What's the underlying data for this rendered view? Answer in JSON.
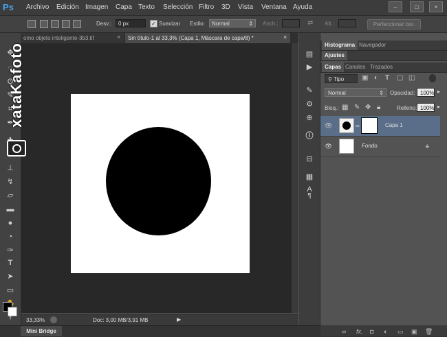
{
  "app": {
    "logo": "Ps"
  },
  "menu": [
    "Archivo",
    "Edición",
    "Imagen",
    "Capa",
    "Texto",
    "Selección",
    "Filtro",
    "3D",
    "Vista",
    "Ventana",
    "Ayuda"
  ],
  "window_controls": {
    "minimize": "–",
    "maximize": "□",
    "close": "×"
  },
  "options": {
    "feather_label": "Desv.:",
    "feather_value": "0 px",
    "antialias_label": "Suavizar",
    "style_label": "Estilo:",
    "style_value": "Normal",
    "width_label": "Anch.:",
    "height_label": "Alt.:",
    "refine_button": "Perfeccionar bor."
  },
  "tabs": [
    {
      "label": "omo objeto inteligente-3b3.tif",
      "close": "×"
    },
    {
      "label": "Sin título-1 al 33,3% (Capa 1, Máscara de capa/8) *",
      "close": "×"
    }
  ],
  "status": {
    "zoom": "33,33%",
    "doc": "Doc: 3,00 MB/3,91 MB"
  },
  "mini_bridge": "Mini Bridge",
  "panel_groups": {
    "top_tabs": [
      "Histograma",
      "Navegador"
    ],
    "adjust_tab": "Ajustes",
    "layer_tabs": [
      "Capas",
      "Canales",
      "Trazados"
    ]
  },
  "layers_panel": {
    "filter_value": "Tipo",
    "blend_mode": "Normal",
    "opacity_label": "Opacidad:",
    "opacity_value": "100%",
    "lock_label": "Bloq.:",
    "fill_label": "Relleno:",
    "fill_value": "100%",
    "layers": [
      {
        "name": "Capa 1",
        "selected": true
      },
      {
        "name": "Fondo",
        "selected": false
      }
    ],
    "footer_icons": [
      "link-icon",
      "fx-icon",
      "mask-icon",
      "adjustment-icon",
      "group-icon",
      "new-layer-icon",
      "trash-icon"
    ]
  },
  "watermark": "xataKafoto",
  "colors": {
    "selection": "#5a6e8a",
    "canvas_bg": "#282828",
    "panel_bg": "#535353",
    "accent": "#4aa3ef"
  }
}
